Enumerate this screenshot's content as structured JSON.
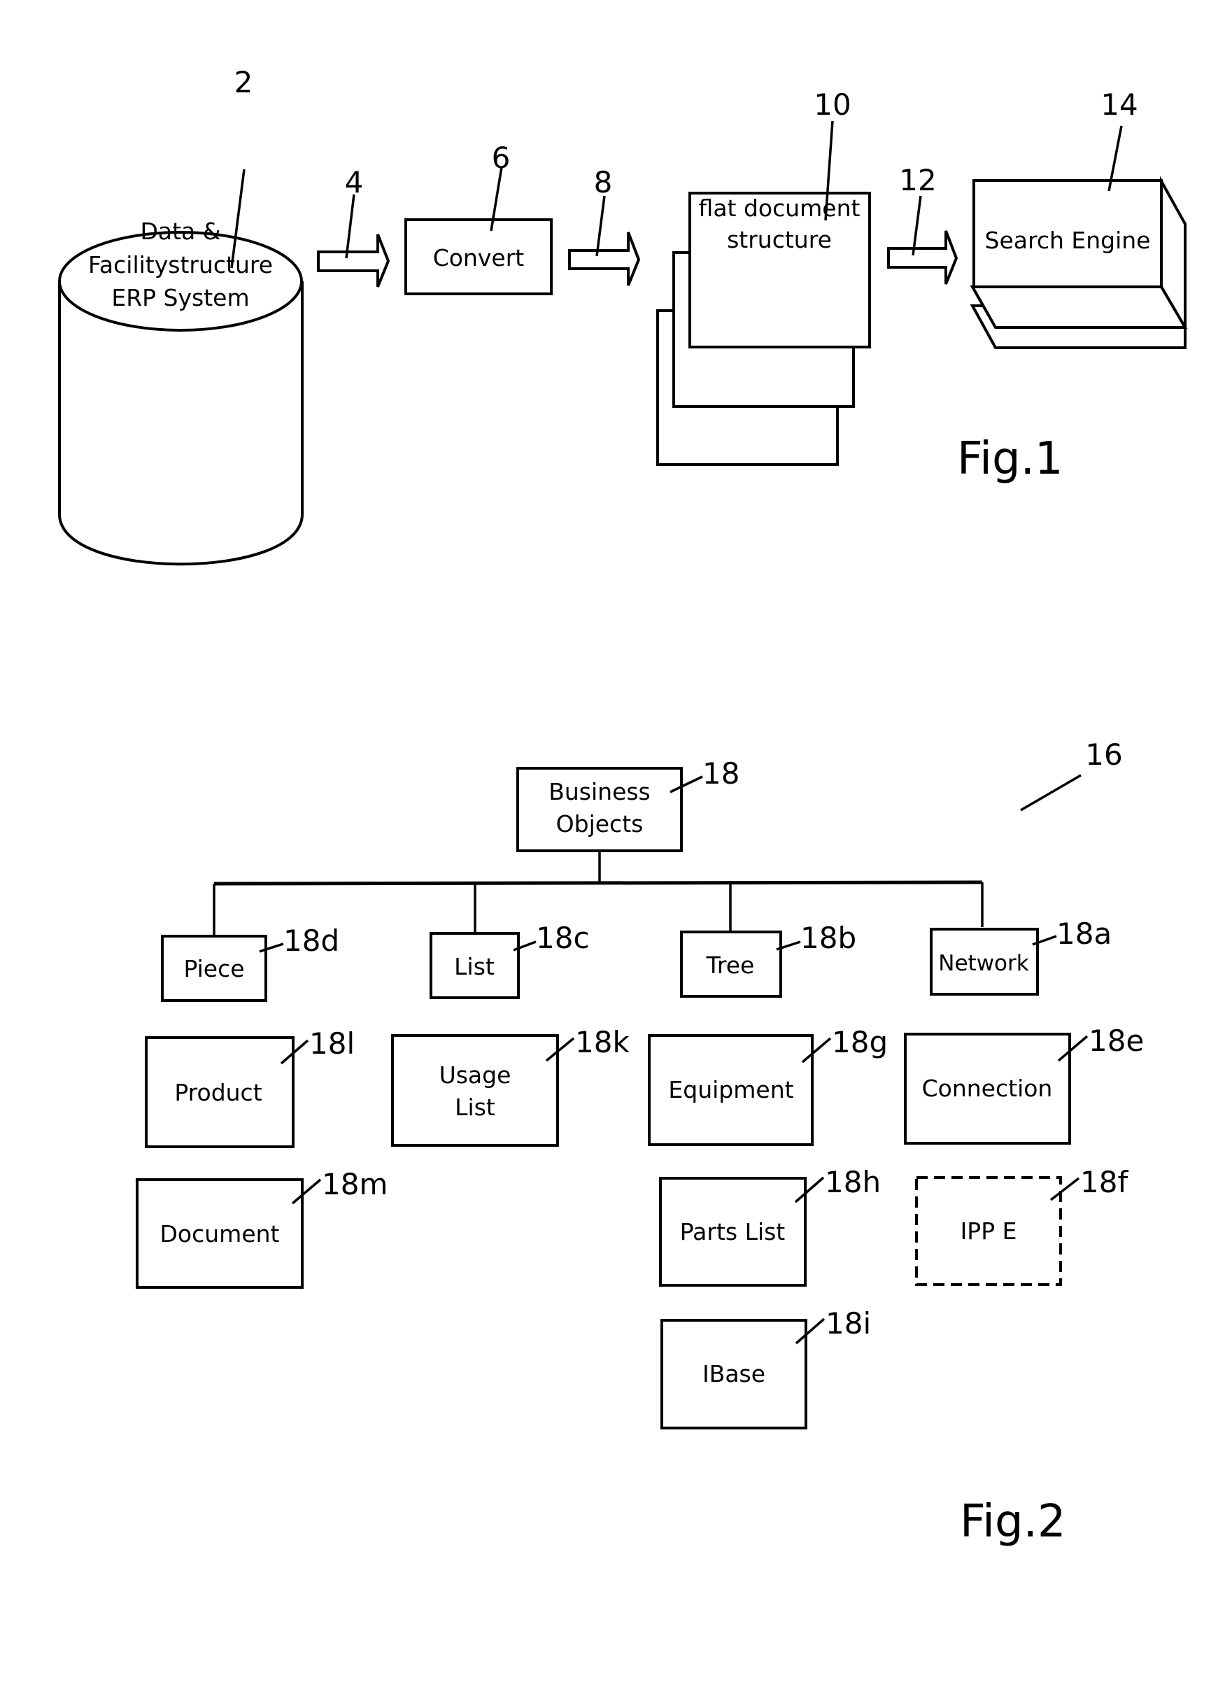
{
  "fig1": {
    "caption": "Fig.1",
    "nodes": {
      "database": {
        "ref": "2",
        "lines": [
          "Data &",
          "Facilitystructure",
          "ERP System"
        ]
      },
      "arrow1": {
        "ref": "4"
      },
      "convert": {
        "ref": "6",
        "label": "Convert"
      },
      "arrow2": {
        "ref": "8"
      },
      "flat_doc": {
        "ref": "10",
        "lines": [
          "flat document",
          "structure"
        ]
      },
      "arrow3": {
        "ref": "12"
      },
      "search_engine": {
        "ref": "14",
        "label": "Search Engine"
      }
    }
  },
  "fig2": {
    "caption": "Fig.2",
    "overall_ref": "16",
    "root": {
      "ref": "18",
      "lines": [
        "Business",
        "Objects"
      ]
    },
    "categories": [
      {
        "ref": "18d",
        "label": "Piece"
      },
      {
        "ref": "18c",
        "label": "List"
      },
      {
        "ref": "18b",
        "label": "Tree"
      },
      {
        "ref": "18a",
        "label": "Network"
      }
    ],
    "items": [
      {
        "ref": "18l",
        "lines": [
          "Product"
        ]
      },
      {
        "ref": "18k",
        "lines": [
          "Usage",
          "List"
        ]
      },
      {
        "ref": "18g",
        "lines": [
          "Equipment"
        ]
      },
      {
        "ref": "18e",
        "lines": [
          "Connection"
        ]
      },
      {
        "ref": "18m",
        "lines": [
          "Document"
        ]
      },
      {
        "ref": "18h",
        "lines": [
          "Parts List"
        ]
      },
      {
        "ref": "18f",
        "lines": [
          "IPP E"
        ],
        "dashed": true
      },
      {
        "ref": "18i",
        "lines": [
          "IBase"
        ]
      }
    ]
  }
}
